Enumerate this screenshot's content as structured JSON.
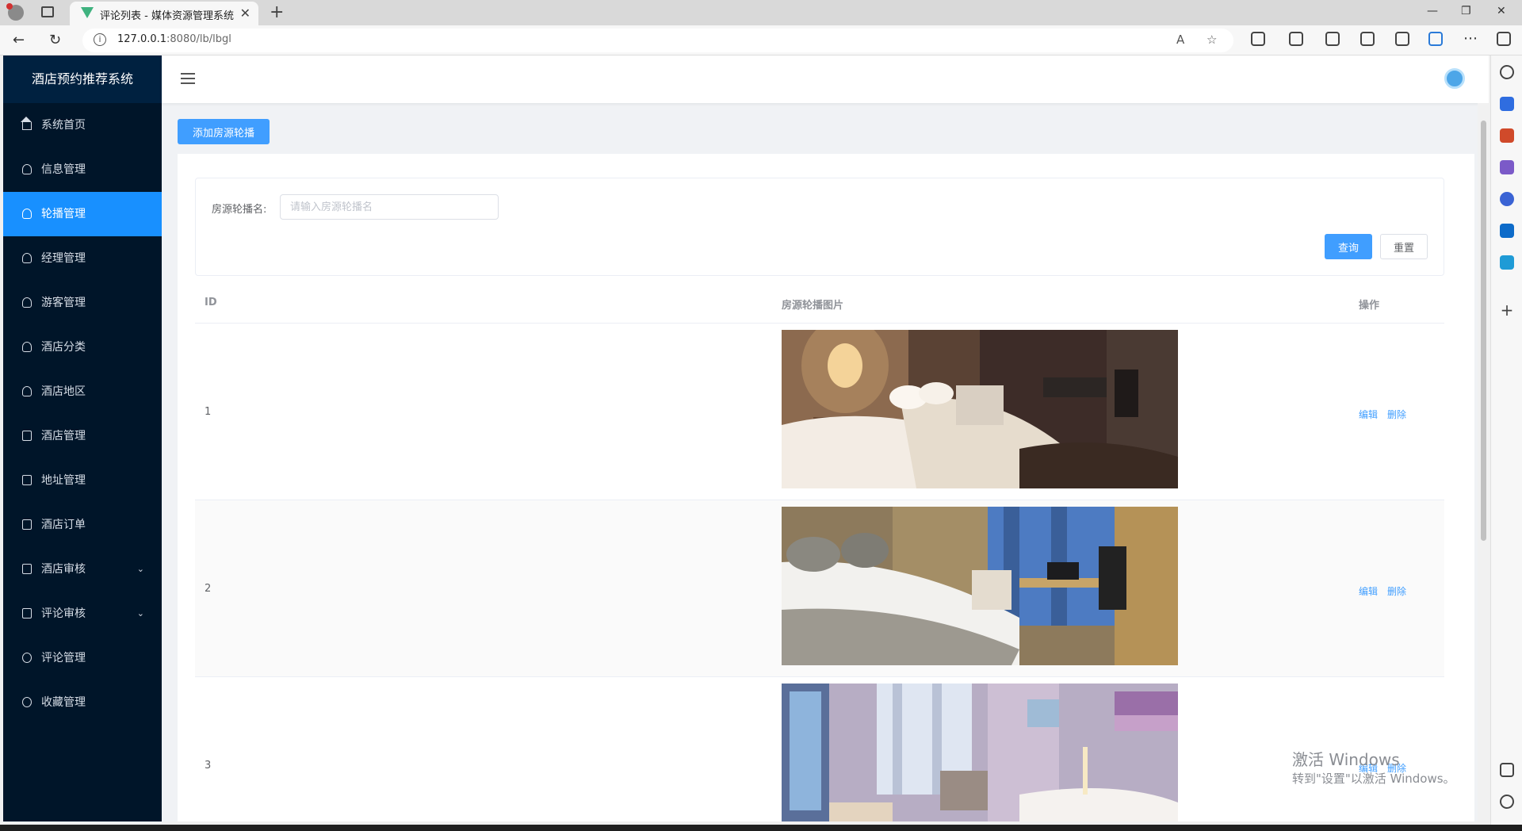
{
  "browser": {
    "tab_title": "评论列表 - 媒体资源管理系统",
    "url_host": "127.0.0.1",
    "url_rest": ":8080/lb/lbgl"
  },
  "app": {
    "brand": "酒店预约推荐系统",
    "menu": [
      {
        "label": "系统首页",
        "icon": "home-icon"
      },
      {
        "label": "信息管理",
        "icon": "user-icon"
      },
      {
        "label": "轮播管理",
        "icon": "user-icon",
        "active": true
      },
      {
        "label": "经理管理",
        "icon": "user-icon"
      },
      {
        "label": "游客管理",
        "icon": "user-icon"
      },
      {
        "label": "酒店分类",
        "icon": "user-icon"
      },
      {
        "label": "酒店地区",
        "icon": "user-icon"
      },
      {
        "label": "酒店管理",
        "icon": "document-icon"
      },
      {
        "label": "地址管理",
        "icon": "document-icon"
      },
      {
        "label": "酒店订单",
        "icon": "document-icon"
      },
      {
        "label": "酒店审核",
        "icon": "document-icon",
        "expandable": true
      },
      {
        "label": "评论审核",
        "icon": "document-icon",
        "expandable": true
      },
      {
        "label": "评论管理",
        "icon": "chat-icon"
      },
      {
        "label": "收藏管理",
        "icon": "chat-icon"
      }
    ]
  },
  "toolbar": {
    "add_label": "添加房源轮播"
  },
  "search": {
    "label": "房源轮播名:",
    "placeholder": "请输入房源轮播名",
    "query_label": "查询",
    "reset_label": "重置"
  },
  "table": {
    "columns": [
      "ID",
      "房源轮播图片",
      "操作"
    ],
    "rows": [
      {
        "id": "1",
        "edit": "编辑",
        "delete": "删除"
      },
      {
        "id": "2",
        "edit": "编辑",
        "delete": "删除"
      },
      {
        "id": "3",
        "edit": "编辑",
        "delete": "删除"
      }
    ]
  },
  "watermark": {
    "line1": "激活 Windows",
    "line2": "转到\"设置\"以激活 Windows。"
  },
  "colors": {
    "sidebar_bg": "#001529",
    "accent": "#1890ff",
    "primary_button": "#409eff"
  }
}
